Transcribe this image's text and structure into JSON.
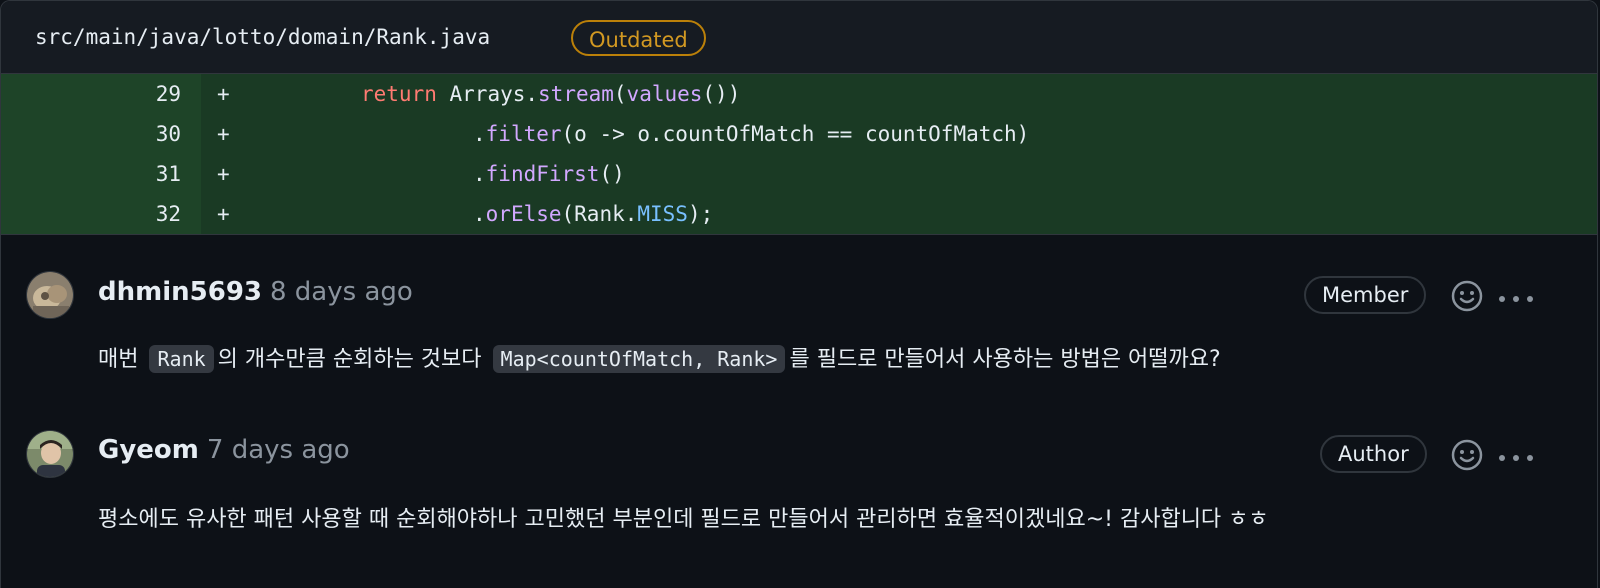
{
  "file": {
    "path": "src/main/java/lotto/domain/Rank.java",
    "badge": "Outdated"
  },
  "diff": [
    {
      "line": "29",
      "sign": "+",
      "parts": [
        [
          "kw",
          "return "
        ],
        [
          "plain",
          "Arrays."
        ],
        [
          "fn",
          "stream"
        ],
        [
          "plain",
          "("
        ],
        [
          "fn",
          "values"
        ],
        [
          "plain",
          "())"
        ]
      ],
      "indent": 0
    },
    {
      "line": "30",
      "sign": "+",
      "parts": [
        [
          "plain",
          "."
        ],
        [
          "fn",
          "filter"
        ],
        [
          "plain",
          "(o -> o.countOfMatch == countOfMatch)"
        ]
      ],
      "indent": 1
    },
    {
      "line": "31",
      "sign": "+",
      "parts": [
        [
          "plain",
          "."
        ],
        [
          "fn",
          "findFirst"
        ],
        [
          "plain",
          "()"
        ]
      ],
      "indent": 1
    },
    {
      "line": "32",
      "sign": "+",
      "parts": [
        [
          "plain",
          "."
        ],
        [
          "fn",
          "orElse"
        ],
        [
          "plain",
          "(Rank."
        ],
        [
          "cst",
          "MISS"
        ],
        [
          "plain",
          ");"
        ]
      ],
      "indent": 1
    }
  ],
  "comments": [
    {
      "author": "dhmin5693",
      "time": "8 days ago",
      "role": "Member",
      "body": {
        "t1": "매번",
        "c1": "Rank",
        "t2": "의 개수만큼 순회하는 것보다",
        "c2": "Map<countOfMatch, Rank>",
        "t3": "를 필드로 만들어서 사용하는 방법은 어떨까요?"
      }
    },
    {
      "author": "Gyeom",
      "time": "7 days ago",
      "role": "Author",
      "body_text": "평소에도 유사한 패턴 사용할 때 순회해야하나 고민했던 부분인데 필드로 만들어서 관리하면 효율적이겠네요~! 감사합니다 ㅎㅎ"
    }
  ],
  "icons": {
    "emoji": "smiley-icon",
    "more": "kebab-horizontal-icon"
  },
  "colors": {
    "background": "#0d1117",
    "added_line": "#1a3a24",
    "added_gutter": "#1e4428",
    "outdated": "#d29922",
    "keyword": "#ff7b72",
    "function": "#d2a8ff",
    "constant": "#79c0ff"
  }
}
